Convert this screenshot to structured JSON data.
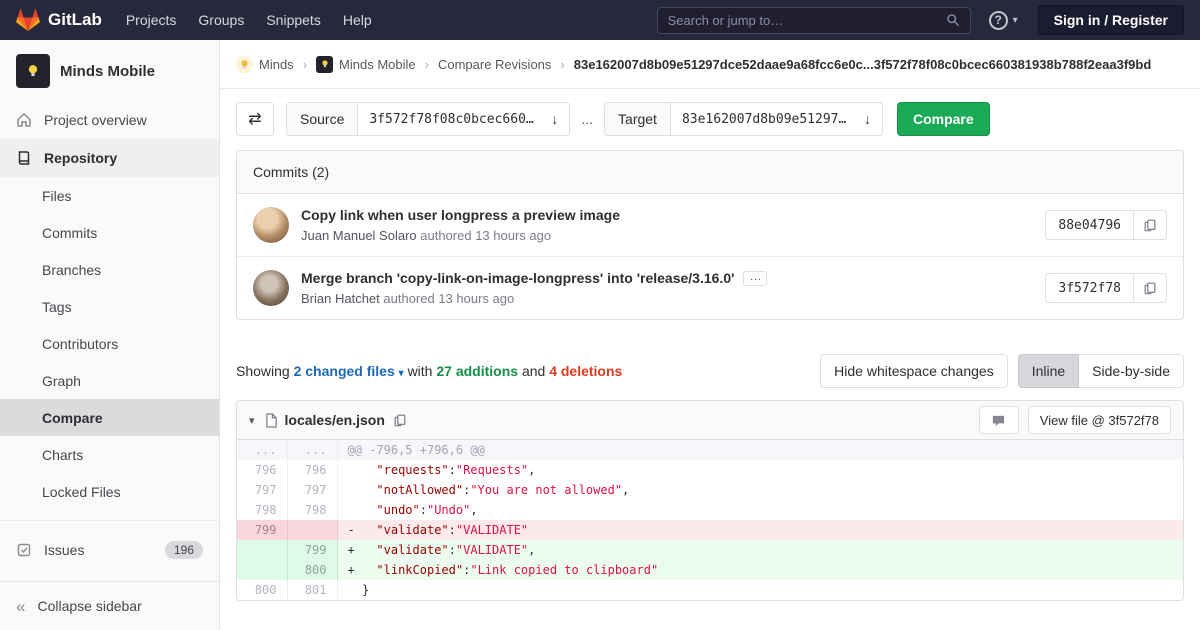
{
  "icons": {
    "help": "?",
    "caret": "▾",
    "swap": "⇄",
    "arrow": "↓",
    "collapse": "«",
    "ellipsis": "…",
    "sep": "›",
    "dots": "..."
  },
  "navbar": {
    "logo_text": "GitLab",
    "links": [
      "Projects",
      "Groups",
      "Snippets",
      "Help"
    ],
    "search_placeholder": "Search or jump to…",
    "signin_label": "Sign in / Register"
  },
  "sidebar": {
    "project_name": "Minds Mobile",
    "overview_label": "Project overview",
    "repository_label": "Repository",
    "repo_subitems": [
      "Files",
      "Commits",
      "Branches",
      "Tags",
      "Contributors",
      "Graph",
      "Compare",
      "Charts",
      "Locked Files"
    ],
    "issues_label": "Issues",
    "issues_count": "196",
    "collapse_label": "Collapse sidebar"
  },
  "breadcrumb": {
    "minds": "Minds",
    "minds_mobile": "Minds Mobile",
    "compare_revisions": "Compare Revisions",
    "current": "83e162007d8b09e51297dce52daae9a68fcc6e0c...3f572f78f08c0bcec660381938b788f2eaa3f9bd"
  },
  "compare_form": {
    "source_label": "Source",
    "source_value": "3f572f78f08c0bcec660…",
    "target_label": "Target",
    "target_value": "83e162007d8b09e51297…",
    "compare_button": "Compare"
  },
  "commits_panel": {
    "header": "Commits (2)",
    "commits": [
      {
        "title": "Copy link when user longpress a preview image",
        "author": "Juan Manuel Solaro",
        "meta": "authored 13 hours ago",
        "sha": "88e04796"
      },
      {
        "title": "Merge branch 'copy-link-on-image-longpress' into 'release/3.16.0'",
        "author": "Brian Hatchet",
        "meta": "authored 13 hours ago",
        "sha": "3f572f78"
      }
    ]
  },
  "diff_stats": {
    "showing": "Showing",
    "files_link": "2 changed files",
    "with_word": "with",
    "additions": "27 additions",
    "and_word": "and",
    "deletions": "4 deletions",
    "hide_whitespace": "Hide whitespace changes",
    "inline": "Inline",
    "side_by_side": "Side-by-side"
  },
  "diff_file": {
    "filename": "locales/en.json",
    "view_file_label": "View file @ 3f572f78",
    "rows": [
      {
        "old": "...",
        "new": "...",
        "code": "@@ -796,5 +796,6 @@"
      },
      {
        "old": "796",
        "new": "796",
        "sign": "",
        "key": "    \"requests\"",
        "colon": ":",
        "str": "\"Requests\"",
        "tail": ","
      },
      {
        "old": "797",
        "new": "797",
        "sign": "",
        "key": "    \"notAllowed\"",
        "colon": ":",
        "str": "\"You are not allowed\"",
        "tail": ","
      },
      {
        "old": "798",
        "new": "798",
        "sign": "",
        "key": "    \"undo\"",
        "colon": ":",
        "str": "\"Undo\"",
        "tail": ","
      },
      {
        "old": "799",
        "new": "",
        "sign": "-",
        "key": "   \"validate\"",
        "colon": ":",
        "str": "\"VALIDATE\"",
        "tail": ""
      },
      {
        "old": "",
        "new": "799",
        "sign": "+",
        "key": "   \"validate\"",
        "colon": ":",
        "str": "\"VALIDATE\"",
        "tail": ","
      },
      {
        "old": "",
        "new": "800",
        "sign": "+",
        "key": "   \"linkCopied\"",
        "colon": ":",
        "str": "\"Link copied to clipboard\"",
        "tail": ""
      },
      {
        "old": "800",
        "new": "801",
        "sign": "",
        "key": "",
        "colon": "",
        "str": "",
        "tail": "",
        "plain": "  }"
      }
    ]
  }
}
